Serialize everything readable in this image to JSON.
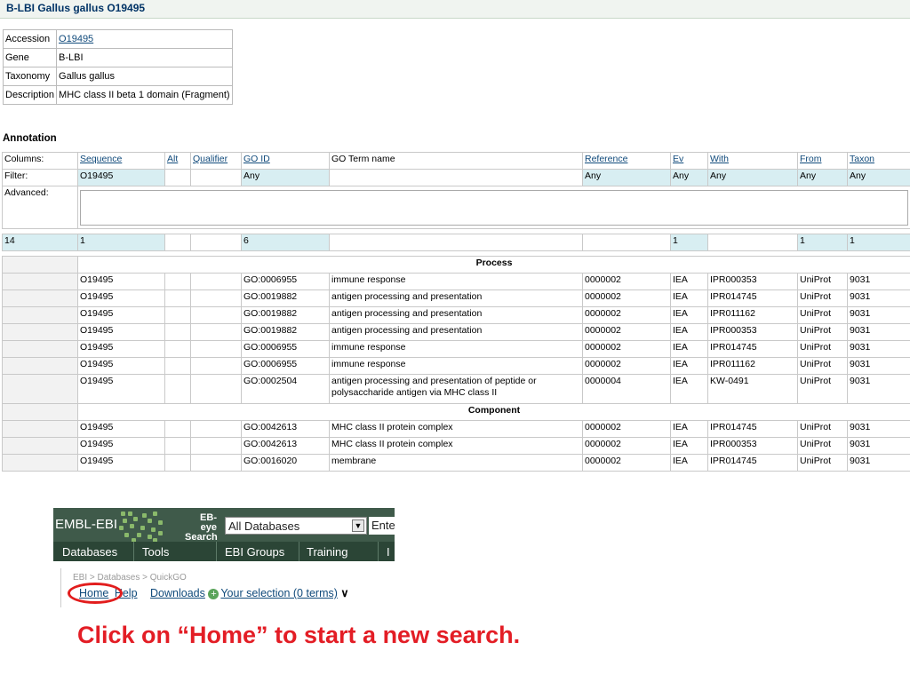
{
  "header": {
    "title": "B-LBI Gallus gallus O19495"
  },
  "info": [
    {
      "key": "Accession",
      "value": "O19495",
      "link": true
    },
    {
      "key": "Gene",
      "value": "B-LBI"
    },
    {
      "key": "Taxonomy",
      "value": "Gallus gallus"
    },
    {
      "key": "Description",
      "value": "MHC class II beta 1 domain (Fragment)"
    }
  ],
  "annotation": {
    "title": "Annotation",
    "columns_label": "Columns:",
    "columns": [
      "Sequence",
      "Alt",
      "Qualifier",
      "GO ID",
      "GO Term name",
      "Reference",
      "Ev",
      "With",
      "From",
      "Taxon"
    ],
    "filter_label": "Filter:",
    "filter": [
      "O19495",
      "",
      "",
      "Any",
      "",
      "Any",
      "Any",
      "Any",
      "Any",
      "Any"
    ],
    "advanced_label": "Advanced:",
    "count_label": "14",
    "counts": [
      "1",
      "",
      "",
      "6",
      "",
      "",
      "1",
      "",
      "1",
      "1"
    ],
    "sections": [
      {
        "name": "Process",
        "rows": [
          [
            "O19495",
            "",
            "",
            "GO:0006955",
            "immune response",
            "0000002",
            "IEA",
            "IPR000353",
            "UniProt",
            "9031"
          ],
          [
            "O19495",
            "",
            "",
            "GO:0019882",
            "antigen processing and presentation",
            "0000002",
            "IEA",
            "IPR014745",
            "UniProt",
            "9031"
          ],
          [
            "O19495",
            "",
            "",
            "GO:0019882",
            "antigen processing and presentation",
            "0000002",
            "IEA",
            "IPR011162",
            "UniProt",
            "9031"
          ],
          [
            "O19495",
            "",
            "",
            "GO:0019882",
            "antigen processing and presentation",
            "0000002",
            "IEA",
            "IPR000353",
            "UniProt",
            "9031"
          ],
          [
            "O19495",
            "",
            "",
            "GO:0006955",
            "immune response",
            "0000002",
            "IEA",
            "IPR014745",
            "UniProt",
            "9031"
          ],
          [
            "O19495",
            "",
            "",
            "GO:0006955",
            "immune response",
            "0000002",
            "IEA",
            "IPR011162",
            "UniProt",
            "9031"
          ],
          [
            "O19495",
            "",
            "",
            "GO:0002504",
            "antigen processing and presentation of peptide or polysaccharide antigen via MHC class II",
            "0000004",
            "IEA",
            "KW-0491",
            "UniProt",
            "9031"
          ]
        ]
      },
      {
        "name": "Component",
        "rows": [
          [
            "O19495",
            "",
            "",
            "GO:0042613",
            "MHC class II protein complex",
            "0000002",
            "IEA",
            "IPR014745",
            "UniProt",
            "9031"
          ],
          [
            "O19495",
            "",
            "",
            "GO:0042613",
            "MHC class II protein complex",
            "0000002",
            "IEA",
            "IPR000353",
            "UniProt",
            "9031"
          ],
          [
            "O19495",
            "",
            "",
            "GO:0016020",
            "membrane",
            "0000002",
            "IEA",
            "IPR014745",
            "UniProt",
            "9031"
          ]
        ]
      }
    ]
  },
  "ebi": {
    "logo": "EMBL-EBI",
    "ebeye_line1": "EB-eye",
    "ebeye_line2": "Search",
    "db_select": "All Databases",
    "search_placeholder": "Ente",
    "nav": [
      "Databases",
      "Tools",
      "EBI Groups",
      "Training",
      "I"
    ],
    "breadcrumb": "EBI > Databases > QuickGO",
    "links": {
      "home": "Home",
      "help": "Help",
      "downloads": "Downloads",
      "selection": "Your selection (0 terms)"
    }
  },
  "caption": "Click on “Home” to start a new search.",
  "colors": {
    "caption": "#e31d25",
    "highlight_circle": "#e21d1d",
    "filter_bg": "#d8eef2",
    "ebi_header": "#3f5a4a"
  }
}
